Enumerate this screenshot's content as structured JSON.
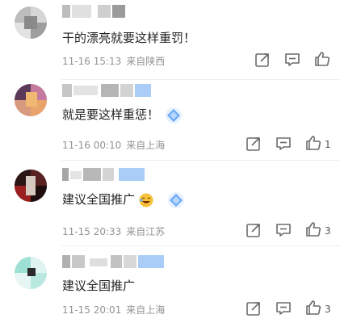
{
  "comments": [
    {
      "text": "干的漂亮就要这样重罚！",
      "date": "11-16",
      "time": "15:13",
      "location": "来自陕西",
      "likes": "",
      "avatar_color": "#b9b9b9"
    },
    {
      "text": "就是要这样重惩！",
      "date": "11-16",
      "time": "00:10",
      "location": "来自上海",
      "likes": "1",
      "avatar_color": "#c56a9a"
    },
    {
      "text": "建议全国推广",
      "date": "11-15",
      "time": "20:33",
      "location": "来自江苏",
      "likes": "3",
      "avatar_color": "#6b2b2b"
    },
    {
      "text": "建议全国推广",
      "date": "11-15",
      "time": "20:01",
      "location": "来自上海",
      "likes": "3",
      "avatar_color": "#7fd8c8"
    }
  ],
  "icons": {
    "share": "share-icon",
    "comment": "comment-icon",
    "like": "thumbs-up-icon",
    "diamond": "diamond-emoji",
    "laugh": "laughing-emoji"
  },
  "colors": {
    "meta": "#939393",
    "text": "#222222",
    "accent_blue": "#6aa8f7"
  }
}
